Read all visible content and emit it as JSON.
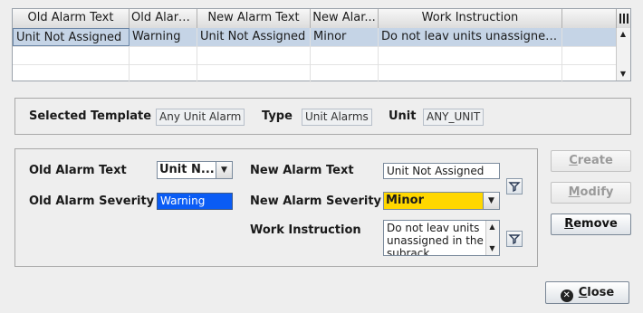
{
  "table": {
    "columns": [
      "Old Alarm Text",
      "Old Alarm...",
      "New Alarm Text",
      "New Alar...",
      "Work Instruction"
    ],
    "rows": [
      [
        "Unit Not Assigned",
        "Warning",
        "Unit Not Assigned",
        "Minor",
        "Do not leav units unassigned ..."
      ]
    ]
  },
  "info": {
    "selected_template_label": "Selected Template",
    "selected_template_value": "Any Unit Alarm",
    "type_label": "Type",
    "type_value": "Unit Alarms",
    "unit_label": "Unit",
    "unit_value": "ANY_UNIT"
  },
  "form": {
    "old_alarm_text_label": "Old Alarm Text",
    "old_alarm_text_value": "Unit N...",
    "old_alarm_severity_label": "Old Alarm Severity",
    "old_alarm_severity_value": "Warning",
    "new_alarm_text_label": "New Alarm Text",
    "new_alarm_text_value": "Unit Not Assigned",
    "new_alarm_severity_label": "New Alarm Severity",
    "new_alarm_severity_value": "Minor",
    "work_instruction_label": "Work Instruction",
    "work_instruction_value": "Do not leav units unassigned in the subrack"
  },
  "buttons": {
    "create_first": "C",
    "create_rest": "reate",
    "modify_first": "M",
    "modify_rest": "odify",
    "remove_first": "R",
    "remove_rest": "emove",
    "close_first": "C",
    "close_rest": "lose"
  },
  "colors": {
    "selection_row": "#c5d4e6",
    "severity_warning": "#0a5cf5",
    "severity_minor": "#ffd700"
  },
  "icons": [
    "column-chooser-icon",
    "template-picker-icon",
    "close-icon"
  ]
}
